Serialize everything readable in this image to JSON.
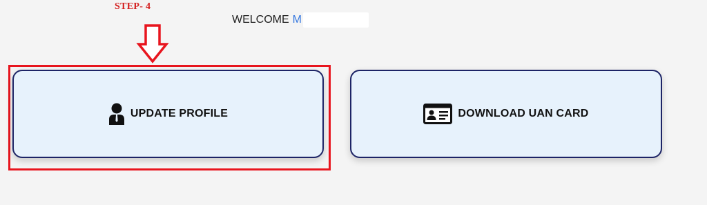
{
  "annotation": {
    "step_label": "STEP- 4"
  },
  "header": {
    "welcome_text": "WELCOME",
    "user_initial": "M"
  },
  "cards": {
    "update_profile": {
      "label": "UPDATE PROFILE",
      "icon": "user-icon"
    },
    "download_uan": {
      "label": "DOWNLOAD UAN CARD",
      "icon": "id-card-icon"
    }
  },
  "colors": {
    "annotation_red": "#e8151e",
    "card_background": "#e7f2fc",
    "card_border": "#1d2466",
    "user_name_blue": "#3a7be0"
  }
}
